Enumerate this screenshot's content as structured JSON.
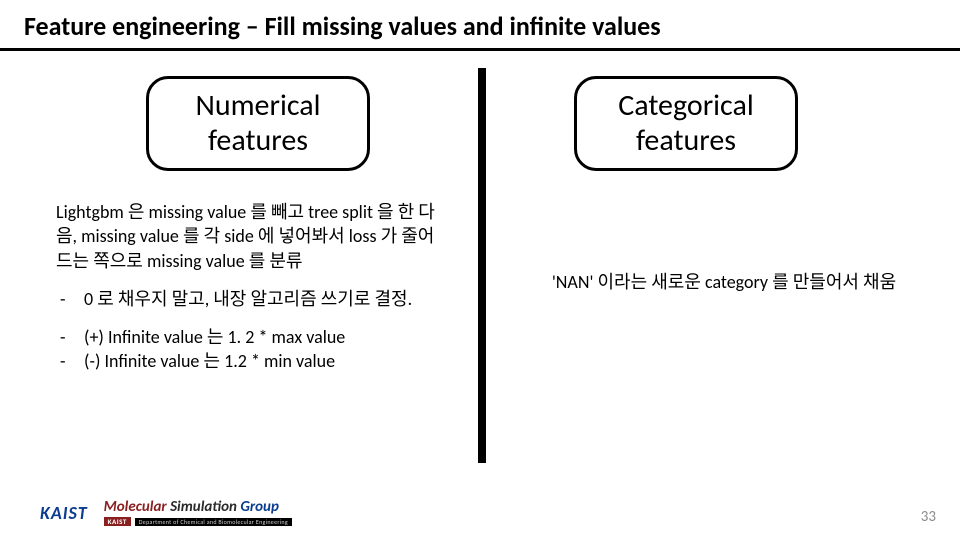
{
  "title": "Feature engineering – Fill missing values and infinite values",
  "cards": {
    "left": "Numerical features",
    "right": "Categorical features"
  },
  "left": {
    "para": "Lightgbm 은 missing value 를 빼고 tree split 을 한 다음, missing value 를 각 side 에 넣어봐서 loss 가 줄어드는 쪽으로 missing value 를 분류",
    "b1": "0 로 채우지 말고, 내장 알고리즘 쓰기로 결정.",
    "b2": "(+) Infinite value 는 1. 2 * max value",
    "b3": "(-) Infinite value 는 1.2 * min value"
  },
  "right": {
    "para": "'NAN' 이라는 새로운 category 를 만들어서 채움"
  },
  "footer": {
    "kaist": "KAIST",
    "msg_molecular": "Molecular ",
    "msg_simulation": "Simulation ",
    "msg_group": "Group",
    "badge": "KAIST",
    "dept": "Department of Chemical and Biomolecular Engineering"
  },
  "page": "33"
}
